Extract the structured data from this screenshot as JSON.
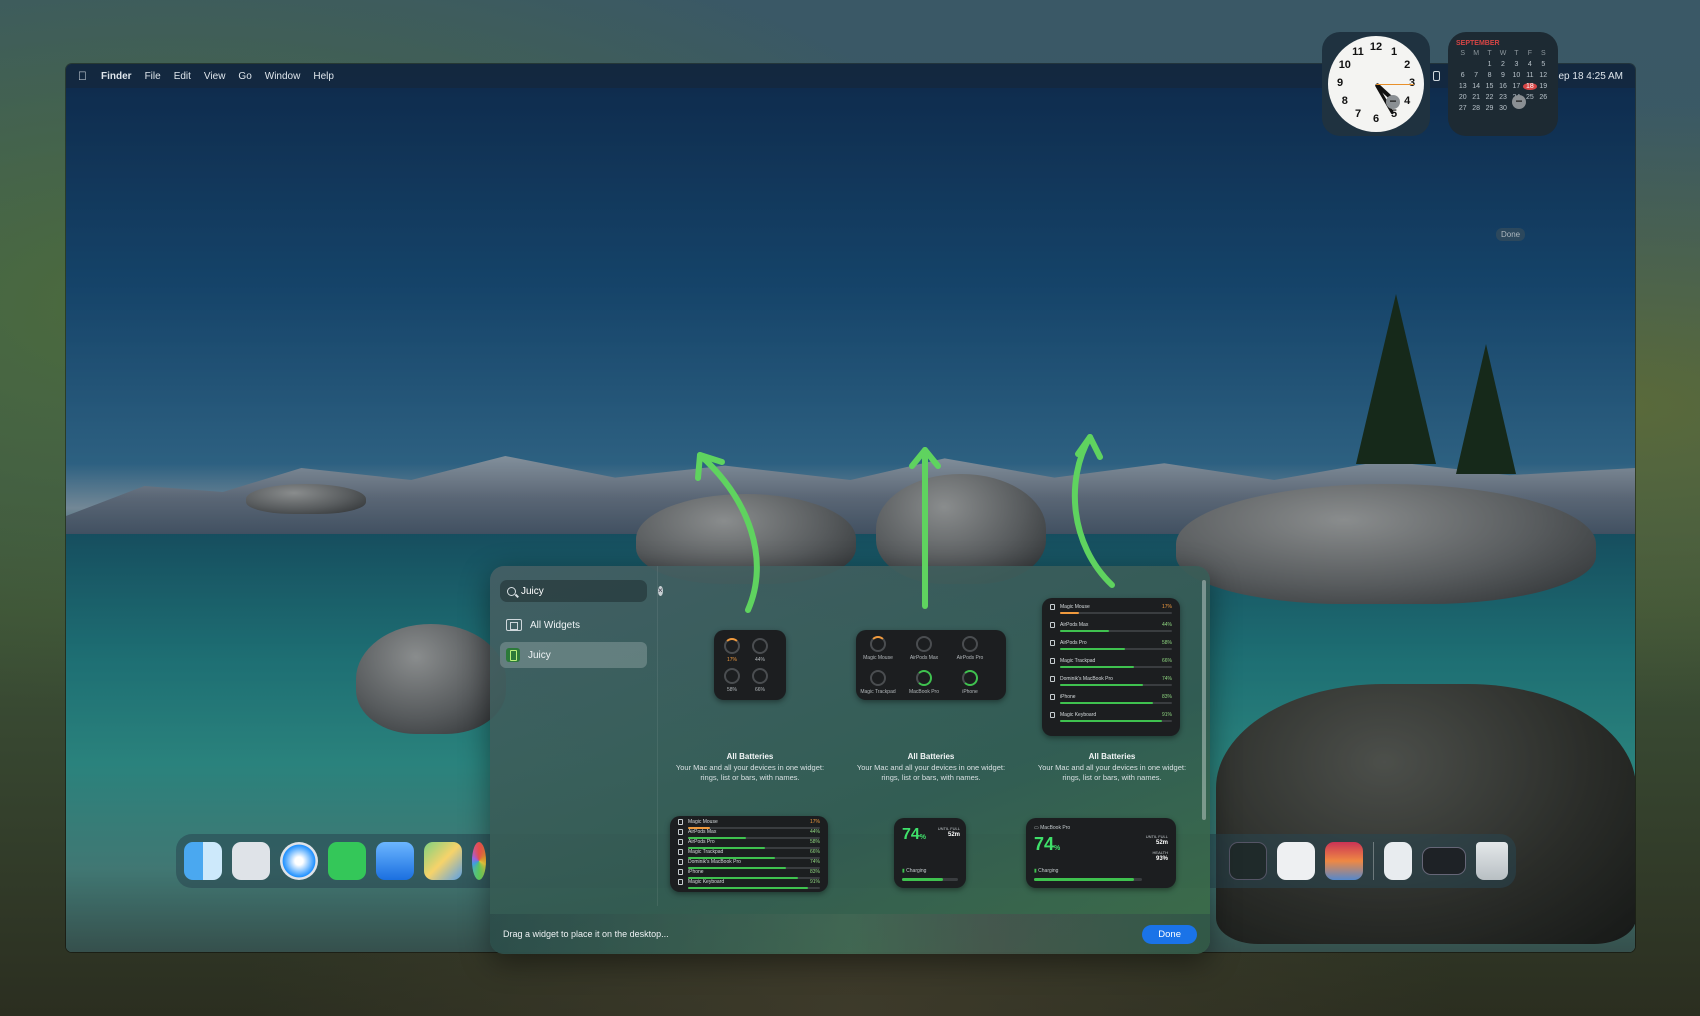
{
  "menubar": {
    "apple_icon": "apple-icon",
    "app_name": "Finder",
    "items": [
      "File",
      "Edit",
      "View",
      "Go",
      "Window",
      "Help"
    ],
    "datetime": "Fri Sep 18  4:25 AM"
  },
  "clock_widget": {
    "numbers": [
      "12",
      "1",
      "2",
      "3",
      "4",
      "5",
      "6",
      "7",
      "8",
      "9",
      "10",
      "11"
    ]
  },
  "calendar_widget": {
    "month": "SEPTEMBER",
    "weekdays": [
      "S",
      "M",
      "T",
      "W",
      "T",
      "F",
      "S"
    ],
    "rows": [
      [
        "",
        "",
        "1",
        "2",
        "3",
        "4",
        "5"
      ],
      [
        "6",
        "7",
        "8",
        "9",
        "10",
        "11",
        "12"
      ],
      [
        "13",
        "14",
        "15",
        "16",
        "17",
        "18",
        "19"
      ],
      [
        "20",
        "21",
        "22",
        "23",
        "24",
        "25",
        "26"
      ],
      [
        "27",
        "28",
        "29",
        "30",
        "",
        "",
        ""
      ]
    ],
    "today": "18"
  },
  "desktop_done_label": "Done",
  "gallery": {
    "search_value": "Juicy",
    "sidebar": {
      "all_widgets": "All Widgets",
      "juicy": "Juicy"
    },
    "widgets": [
      {
        "title": "All Batteries",
        "description": "Your Mac and all your devices in one widget: rings, list or bars, with names."
      },
      {
        "title": "All Batteries",
        "description": "Your Mac and all your devices in one widget: rings, list or bars, with names."
      },
      {
        "title": "All Batteries",
        "description": "Your Mac and all your devices in one widget: rings, list or bars, with names."
      }
    ],
    "small_rings": {
      "labels": [
        "17%",
        "44%",
        "58%",
        "66%"
      ]
    },
    "medium_rings": {
      "labels": [
        "Magic Mouse",
        "AirPods Max",
        "AirPods Pro",
        "Magic Trackpad",
        "MacBook Pro",
        "iPhone"
      ]
    },
    "large_list": {
      "rows": [
        {
          "name": "Magic Mouse",
          "pct": "17%",
          "level": 0.17
        },
        {
          "name": "AirPods Max",
          "pct": "44%",
          "level": 0.44
        },
        {
          "name": "AirPods Pro",
          "pct": "58%",
          "level": 0.58
        },
        {
          "name": "Magic Trackpad",
          "pct": "66%",
          "level": 0.66
        },
        {
          "name": "Dominik's MacBook Pro",
          "pct": "74%",
          "level": 0.74
        },
        {
          "name": "iPhone",
          "pct": "83%",
          "level": 0.83
        },
        {
          "name": "Magic Keyboard",
          "pct": "91%",
          "level": 0.91
        }
      ]
    },
    "mac_small": {
      "pct": "74",
      "pct_unit": "%",
      "until_full": "UNTIL FULL",
      "time": "52m",
      "status": "Charging"
    },
    "mac_medium": {
      "device": "MacBook Pro",
      "pct": "74",
      "pct_unit": "%",
      "until_full": "UNTIL FULL",
      "time": "52m",
      "health_label": "HEALTH",
      "health": "93%",
      "status": "Charging"
    },
    "footer_hint": "Drag a widget to place it on the desktop...",
    "done_label": "Done"
  },
  "colors": {
    "accent": "#1a73e8",
    "arrow": "#5fd35f",
    "battery_green": "#3fc24f",
    "battery_orange": "#f09a3e"
  }
}
